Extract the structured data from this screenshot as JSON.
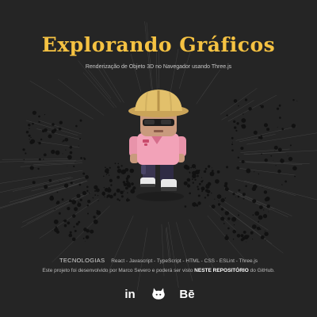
{
  "header": {
    "title": "Explorando Gráficos",
    "subtitle": "Renderização de Objeto 3D no Navegador usando Three.js"
  },
  "scene": {
    "character_icon": "3d-character-hard-hat-icon",
    "colors": {
      "background": "#252525",
      "title": "#f5c242",
      "helmet": "#e2c06b",
      "shirt": "#f2a2b8",
      "pants": "#3a3550",
      "shoes": "#e9e9e9"
    }
  },
  "footer": {
    "tech_label": "TECNOLOGIAS",
    "tech_list": "React - Javascript - TypeScript - HTML - CSS - ESLint - Three.js",
    "credits_prefix": "Este projeto foi desenvolvido por Marco Severo e poderá ser visto",
    "repo_link": "NESTE REPOSITÓRIO",
    "credits_suffix": "do GitHub."
  },
  "social": {
    "linkedin": {
      "label": "in",
      "icon": "linkedin-icon"
    },
    "github": {
      "icon": "github-icon"
    },
    "behance": {
      "label": "Bē",
      "icon": "behance-icon"
    }
  }
}
